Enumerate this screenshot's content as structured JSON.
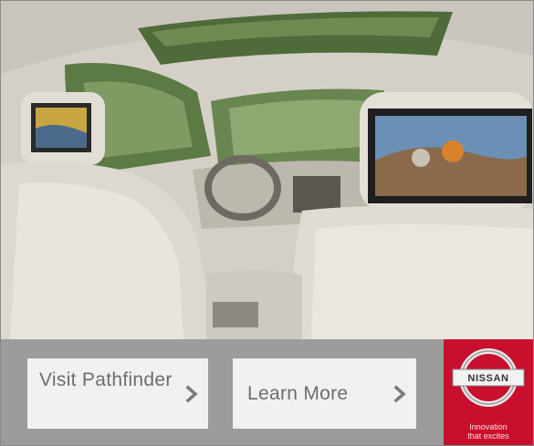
{
  "buttons": {
    "visit_label": "Visit Pathfinder",
    "learn_label": "Learn More"
  },
  "brand": {
    "name": "NISSAN",
    "tagline_line1": "Innovation",
    "tagline_line2": "that excites",
    "color": "#c8102e"
  },
  "icons": {
    "chevron": "chevron-right-icon",
    "logo": "nissan-logo"
  },
  "colors": {
    "bar_bg": "#9c9c9c",
    "button_bg": "#f1f1f1",
    "button_text": "#6d6d6d"
  }
}
